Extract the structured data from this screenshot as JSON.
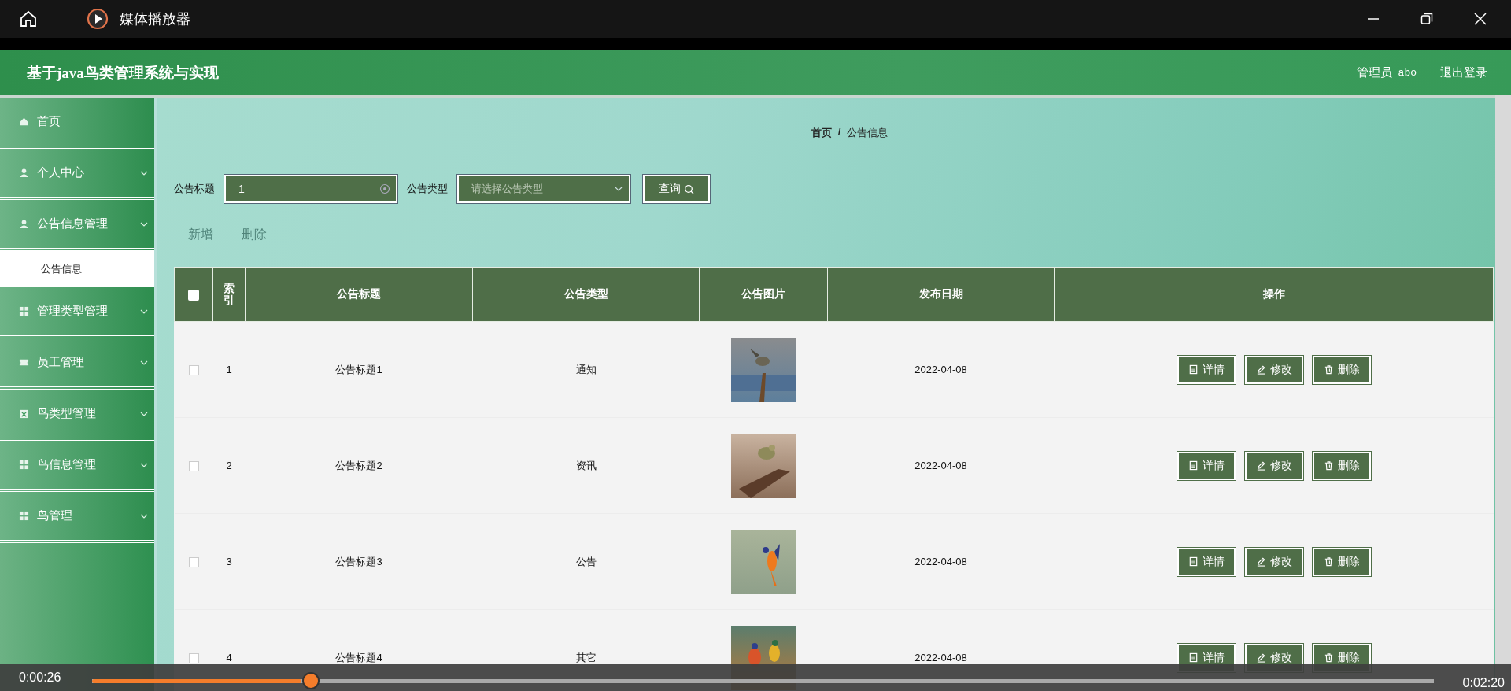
{
  "player": {
    "title": "媒体播放器",
    "elapsed": "0:00:26",
    "duration": "0:02:20",
    "level": 0.163
  },
  "app": {
    "title": "基于java鸟类管理系统与实现",
    "user_role": "管理员",
    "user_name": "abo",
    "logout": "退出登录"
  },
  "sidebar": {
    "items": [
      {
        "label": "首页",
        "expandable": false
      },
      {
        "label": "个人中心",
        "expandable": true
      },
      {
        "label": "公告信息管理",
        "expandable": true,
        "children": [
          {
            "label": "公告信息",
            "selected": true
          }
        ]
      },
      {
        "label": "管理类型管理",
        "expandable": true
      },
      {
        "label": "员工管理",
        "expandable": true
      },
      {
        "label": "鸟类型管理",
        "expandable": true
      },
      {
        "label": "鸟信息管理",
        "expandable": true
      },
      {
        "label": "鸟管理",
        "expandable": true
      }
    ]
  },
  "breadcrumb": [
    "首页",
    "公告信息"
  ],
  "breadcrumb_separator": "/",
  "search": {
    "title_label": "公告标题",
    "title_value": "1",
    "type_label": "公告类型",
    "type_placeholder": "请选择公告类型",
    "button": "查询"
  },
  "actions": [
    {
      "label": "新增",
      "disabled": true
    },
    {
      "label": "删除",
      "disabled": true
    }
  ],
  "table": {
    "header_checked": false,
    "columns": [
      "索引",
      "公告标题",
      "公告类型",
      "公告图片",
      "发布日期",
      "操作"
    ],
    "rows": [
      {
        "checked": false,
        "index": "1",
        "title": "公告标题1",
        "type": "通知",
        "image": {
          "kind": "picture"
        },
        "date": "2022-04-08",
        "buttons": [
          "详情",
          "修改",
          "删除"
        ]
      },
      {
        "checked": false,
        "index": "2",
        "title": "公告标题2",
        "type": "资讯",
        "image": {
          "kind": "picture"
        },
        "date": "2022-04-08",
        "buttons": [
          "详情",
          "修改",
          "删除"
        ]
      },
      {
        "checked": false,
        "index": "3",
        "title": "公告标题3",
        "type": "公告",
        "image": {
          "kind": "picture"
        },
        "date": "2022-04-08",
        "buttons": [
          "详情",
          "修改",
          "删除"
        ]
      },
      {
        "checked": false,
        "index": "4",
        "title": "公告标题4",
        "type": "其它",
        "image": {
          "kind": "picture"
        },
        "date": "2022-04-08",
        "buttons": [
          "详情",
          "修改",
          "删除"
        ]
      }
    ]
  }
}
